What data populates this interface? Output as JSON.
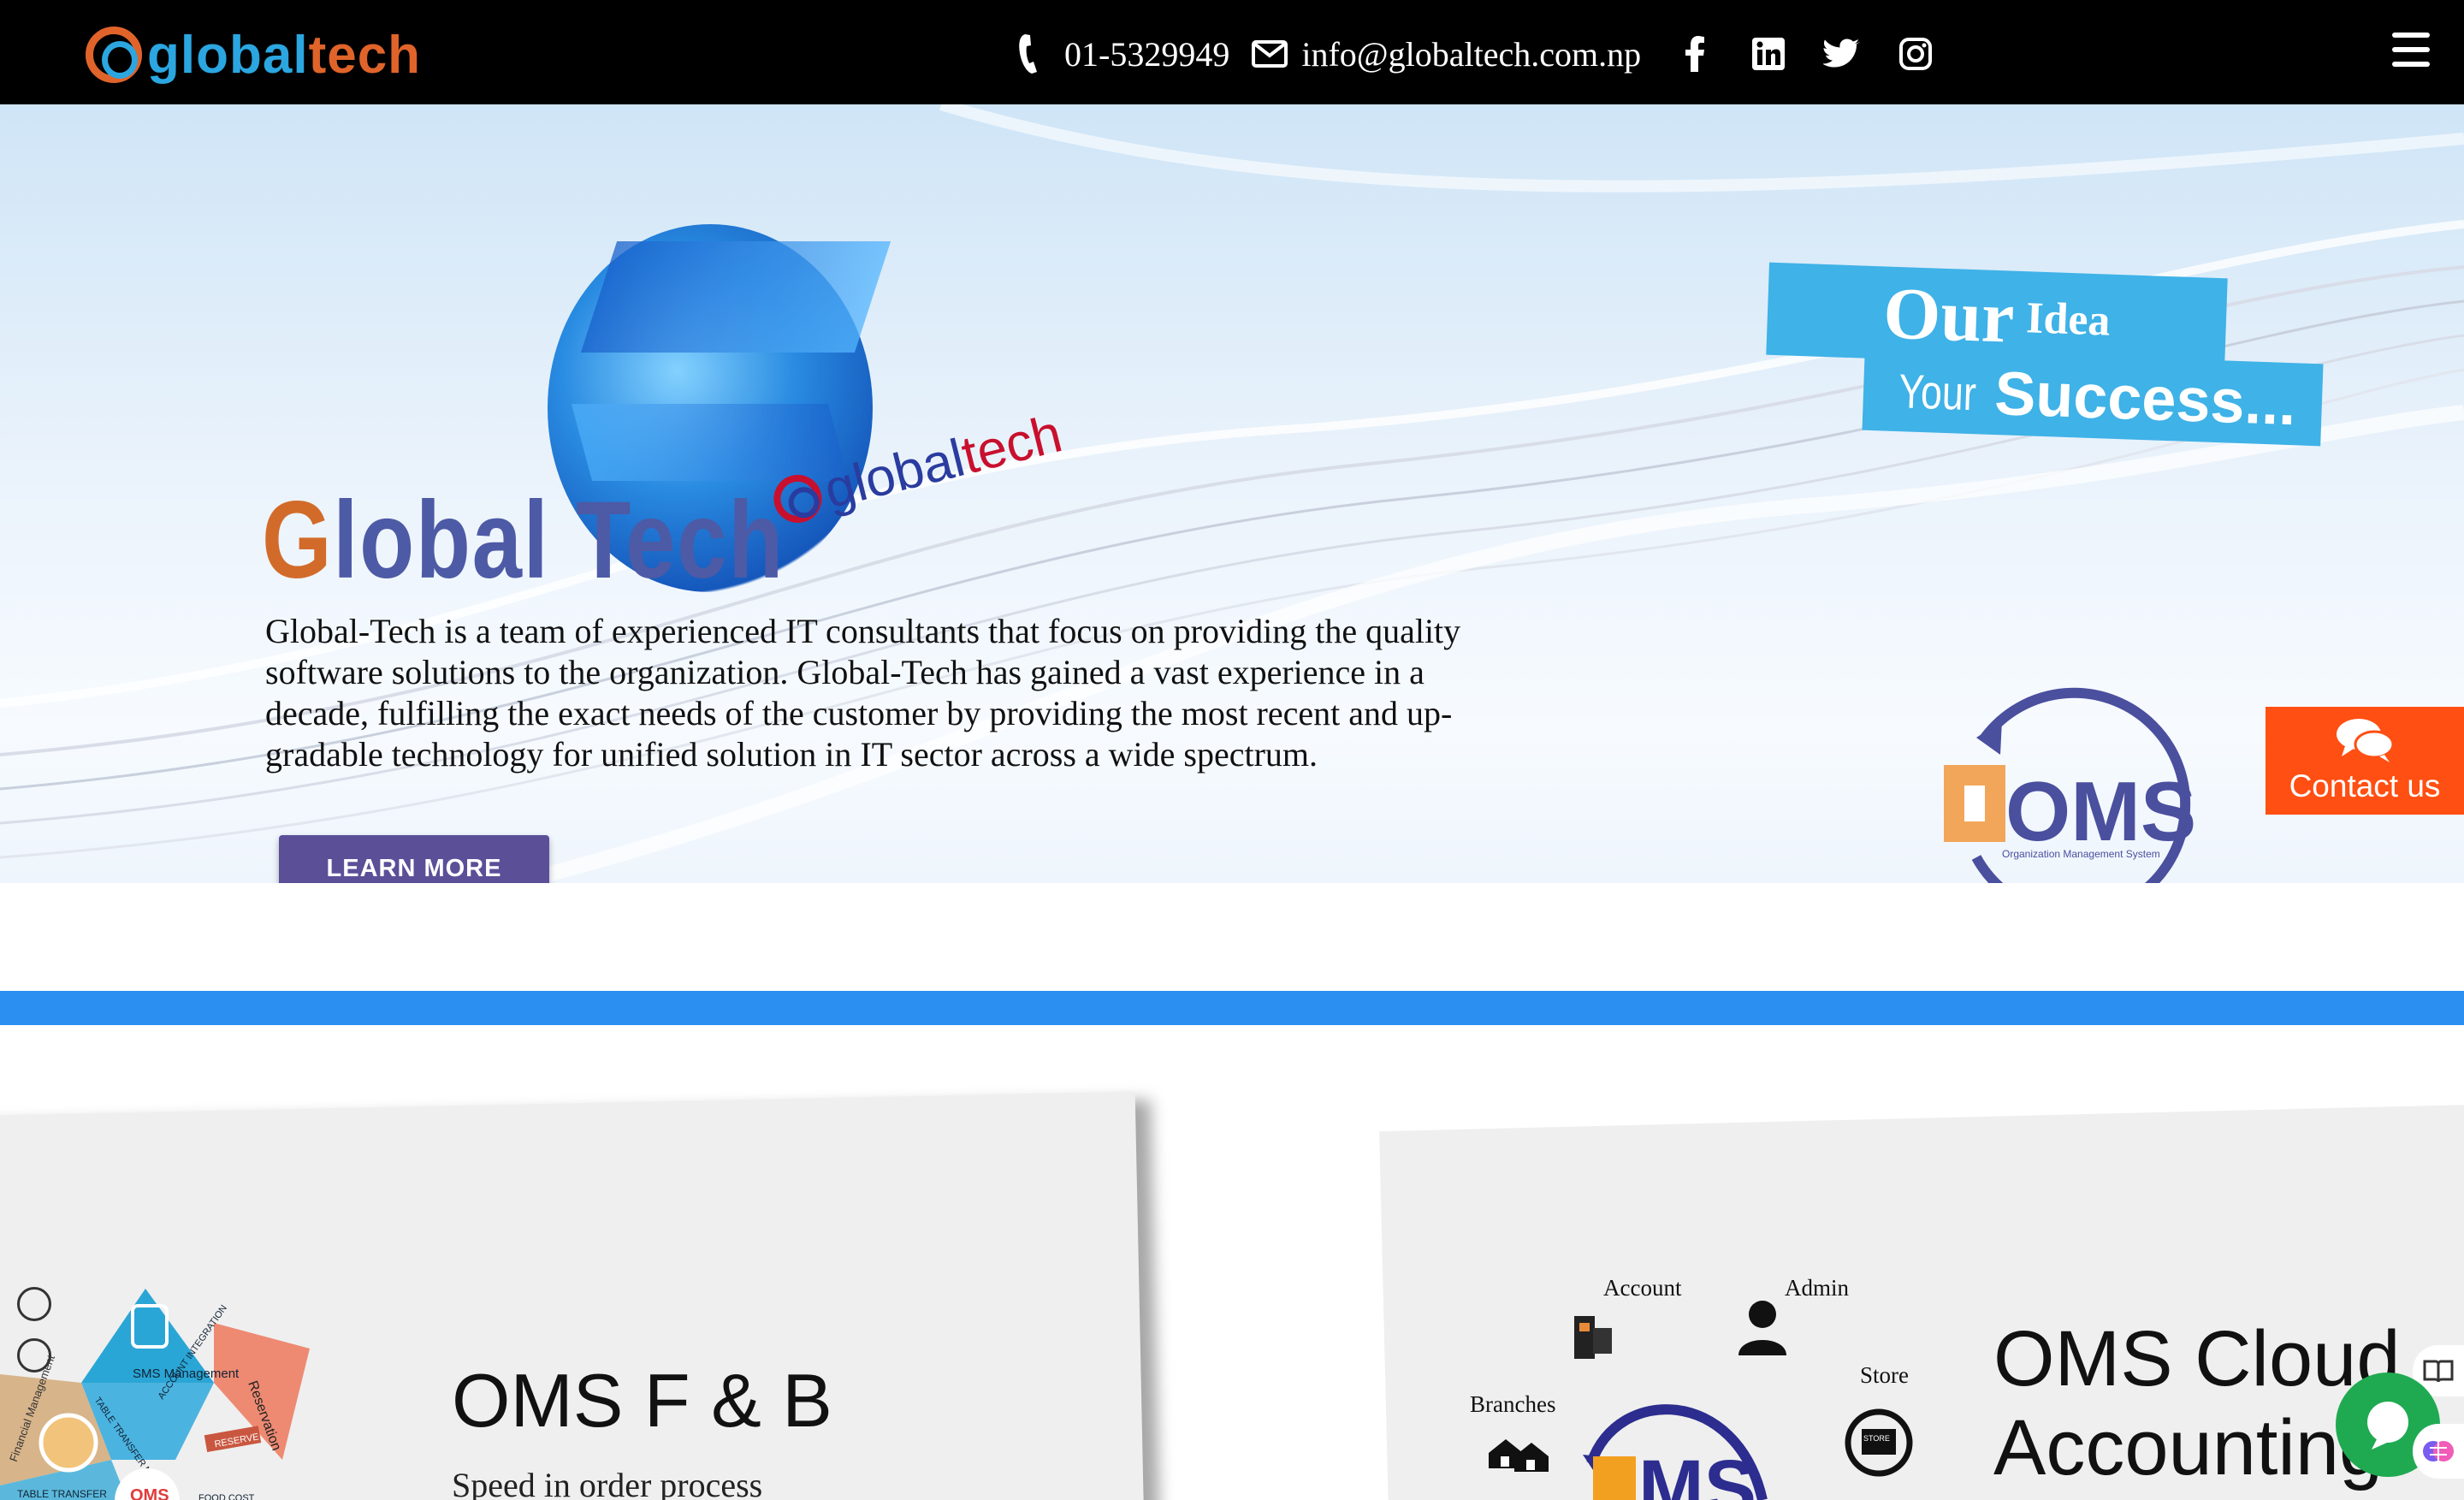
{
  "header": {
    "logo": {
      "part1": "g",
      "part2": "lobal",
      "part3": "tech"
    },
    "phone": "01-5329949",
    "email": "info@globaltech.com.np",
    "social_icons": [
      "facebook-icon",
      "linkedin-icon",
      "twitter-icon",
      "instagram-icon"
    ],
    "menu_icon": "hamburger-menu-icon"
  },
  "hero": {
    "globe_brand": {
      "g": "g",
      "a": "global",
      "b": "tech"
    },
    "title_initial": "G",
    "title_rest": "lobal Tech",
    "description": "Global-Tech is a team of experienced IT consultants that focus on providing the quality software solutions to the organization. Global-Tech has gained a vast experience in a decade, fulfilling the exact needs of the customer by providing the most recent and up-gradable technology for unified solution in IT sector across a wide spectrum.",
    "learn_more": "LEARN MORE",
    "tagline_our": "Our",
    "tagline_idea": "Idea",
    "tagline_your": "Your",
    "tagline_success": "Success...",
    "oms_logo_text": "OMS",
    "oms_logo_sub": "Organization Management System",
    "contact_label": "Contact us"
  },
  "cards": {
    "left": {
      "title": "OMS F & B",
      "subtitle": "Speed in order process",
      "graphic_labels": [
        "SMS Management",
        "Reservation",
        "TABLE TRANSFER MERGE",
        "ACCOUNT INTEGRATION",
        "RESERVE",
        "Financial Management",
        "TABLE TRANSFER",
        "FOOD COST",
        "OMS"
      ]
    },
    "right": {
      "title": "OMS Cloud Accounting",
      "graphic_labels": {
        "account": "Account",
        "admin": "Admin",
        "branches": "Branches",
        "store": "Store",
        "store_badge": "STORE"
      }
    }
  },
  "colors": {
    "header_bg": "#000000",
    "brand_blue": "#2ba6e0",
    "brand_orange": "#e0642a",
    "title_purple": "#4d5aa5",
    "button_purple": "#5b4f98",
    "contact_orange": "#ff4f12",
    "divider_blue": "#2a8ff0",
    "chat_green": "#1faa52"
  }
}
